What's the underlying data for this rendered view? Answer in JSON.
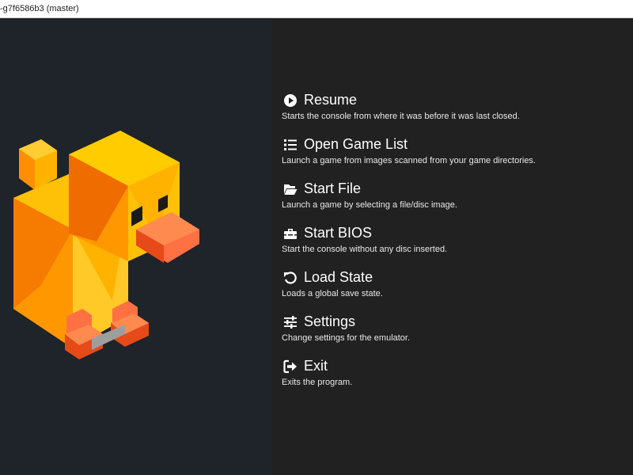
{
  "window": {
    "title": "-g7f6586b3 (master)"
  },
  "logo": {
    "icon": "duck-mascot-icon",
    "colors": [
      "#f7b500",
      "#ff9800",
      "#ef6c00",
      "#e64a19",
      "#ffcc00",
      "#9e9e9e"
    ]
  },
  "menu": {
    "items": [
      {
        "icon": "play-circle-icon",
        "label": "Resume",
        "description": "Starts the console from where it was before it was last closed."
      },
      {
        "icon": "list-icon",
        "label": "Open Game List",
        "description": "Launch a game from images scanned from your game directories."
      },
      {
        "icon": "folder-open-icon",
        "label": "Start File",
        "description": "Launch a game by selecting a file/disc image."
      },
      {
        "icon": "toolbox-icon",
        "label": "Start BIOS",
        "description": "Start the console without any disc inserted."
      },
      {
        "icon": "undo-icon",
        "label": "Load State",
        "description": "Loads a global save state."
      },
      {
        "icon": "sliders-icon",
        "label": "Settings",
        "description": "Change settings for the emulator."
      },
      {
        "icon": "sign-out-icon",
        "label": "Exit",
        "description": "Exits the program."
      }
    ]
  },
  "colors": {
    "left_background": "#1f232a",
    "right_background": "#212121",
    "text": "#ffffff"
  }
}
